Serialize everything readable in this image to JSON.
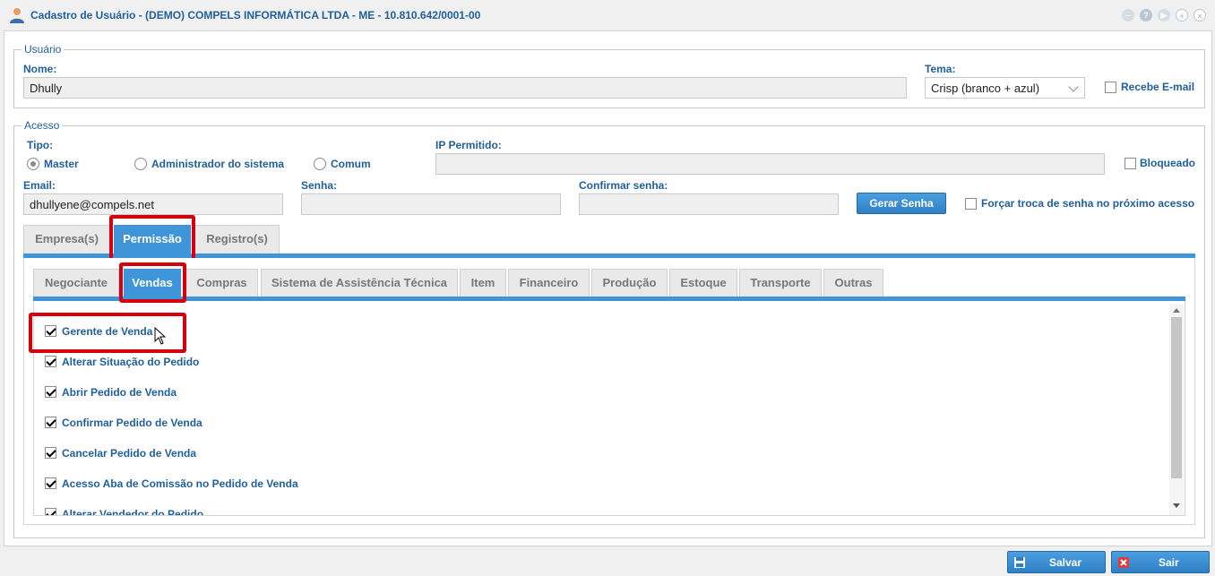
{
  "window": {
    "title": "Cadastro de Usuário - (DEMO) COMPELS INFORMÁTICA LTDA - ME - 10.810.642/0001-00",
    "controls": [
      "minimize-icon",
      "help-icon",
      "play-icon",
      "move-icon",
      "close-icon"
    ]
  },
  "usuario": {
    "legend": "Usuário",
    "nome_label": "Nome:",
    "nome_value": "Dhully",
    "tema_label": "Tema:",
    "tema_value": "Crisp (branco + azul)",
    "recebe_email_label": "Recebe E-mail",
    "recebe_email_checked": false
  },
  "acesso": {
    "legend": "Acesso",
    "tipo_label": "Tipo:",
    "tipo_options": [
      "Master",
      "Administrador do sistema",
      "Comum"
    ],
    "tipo_selected": "Master",
    "ip_label": "IP Permitido:",
    "ip_value": "",
    "bloqueado_label": "Bloqueado",
    "email_label": "Email:",
    "email_value": "dhullyene@compels.net",
    "senha_label": "Senha:",
    "confirmar_label": "Confirmar senha:",
    "gerar_senha": "Gerar Senha",
    "forcar_troca_label": "Forçar troca de senha no próximo acesso"
  },
  "main_tabs": [
    "Empresa(s)",
    "Permissão",
    "Registro(s)"
  ],
  "main_tab_active": "Permissão",
  "sub_tabs": [
    "Negociante",
    "Vendas",
    "Compras",
    "Sistema de Assistência Técnica",
    "Item",
    "Financeiro",
    "Produção",
    "Estoque",
    "Transporte",
    "Outras"
  ],
  "sub_tab_active": "Vendas",
  "permissions": [
    {
      "label": "Gerente de Venda",
      "checked": true
    },
    {
      "label": "Alterar Situação do Pedido",
      "checked": true
    },
    {
      "label": "Abrir Pedido de Venda",
      "checked": true
    },
    {
      "label": "Confirmar Pedido de Venda",
      "checked": true
    },
    {
      "label": "Cancelar Pedido de Venda",
      "checked": true
    },
    {
      "label": "Acesso Aba de Comissão no Pedido de Venda",
      "checked": true
    },
    {
      "label": "Alterar Vendedor do Pedido",
      "checked": true
    }
  ],
  "footer": {
    "salvar": "Salvar",
    "sair": "Sair"
  },
  "colors": {
    "accent": "#3f95d8",
    "label": "#1f5f9c",
    "highlight": "#d4000b"
  }
}
